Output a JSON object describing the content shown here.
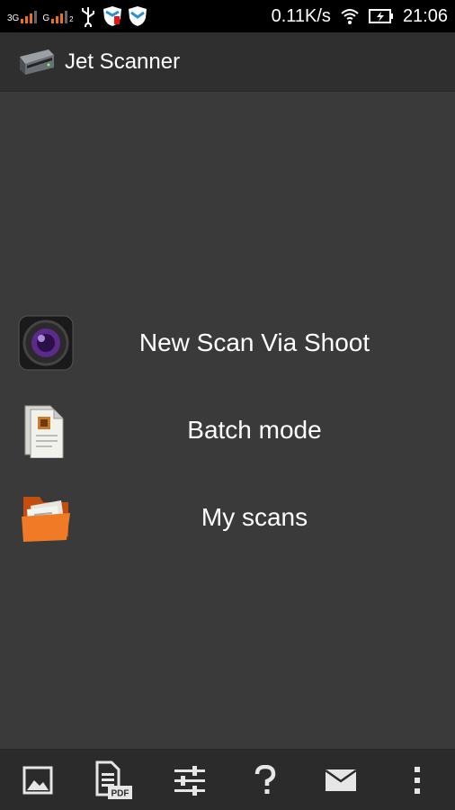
{
  "status_bar": {
    "net1": "3G",
    "net2": "G",
    "net2_sub": "2",
    "speed": "0.11K/s",
    "time": "21:06"
  },
  "action_bar": {
    "title": "Jet Scanner",
    "icon": "scanner-icon"
  },
  "menu": {
    "items": [
      {
        "label": "New Scan Via Shoot",
        "icon": "camera-lens-icon"
      },
      {
        "label": "Batch mode",
        "icon": "document-stack-icon"
      },
      {
        "label": "My scans",
        "icon": "folder-documents-icon"
      }
    ]
  },
  "bottom_bar": {
    "buttons": [
      {
        "icon": "image-icon"
      },
      {
        "icon": "pdf-document-icon",
        "badge": "PDF"
      },
      {
        "icon": "settings-sliders-icon"
      },
      {
        "icon": "help-icon"
      },
      {
        "icon": "mail-icon"
      },
      {
        "icon": "overflow-menu-icon"
      }
    ]
  },
  "colors": {
    "accent_orange": "#e8731a",
    "background": "#3a3a3a",
    "action_bar": "#2f2f2f"
  }
}
